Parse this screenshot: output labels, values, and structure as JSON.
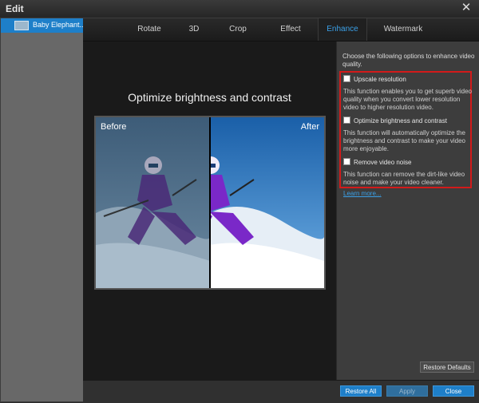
{
  "window": {
    "title": "Edit",
    "close_icon": "close-icon"
  },
  "sidebar": {
    "items": [
      {
        "label": "Baby Elephant..."
      }
    ]
  },
  "tabs": [
    {
      "label": "Rotate"
    },
    {
      "label": "3D"
    },
    {
      "label": "Crop"
    },
    {
      "label": "Effect"
    },
    {
      "label": "Enhance",
      "active": true
    },
    {
      "label": "Watermark"
    }
  ],
  "preview": {
    "heading": "Optimize brightness and contrast",
    "before_label": "Before",
    "after_label": "After"
  },
  "enhance": {
    "intro": "Choose the following options to enhance video quality.",
    "options": [
      {
        "label": "Upscale resolution",
        "checked": false,
        "description": "This function enables you to get superb video quality when you convert lower resolution video to higher resolution video."
      },
      {
        "label": "Optimize brightness and contrast",
        "checked": false,
        "description": "This function will automatically optimize the brightness and contrast to make your video more enjoyable."
      },
      {
        "label": "Remove video noise",
        "checked": false,
        "description": "This function can remove the dirt-like video noise and make your video cleaner."
      }
    ],
    "learn_more": "Learn more..."
  },
  "buttons": {
    "restore_defaults": "Restore Defaults",
    "restore_all": "Restore All",
    "apply": "Apply",
    "close": "Close"
  },
  "colors": {
    "accent": "#1e7fc9",
    "highlight_border": "#d21a1a",
    "active_tab": "#3aa0e8"
  }
}
